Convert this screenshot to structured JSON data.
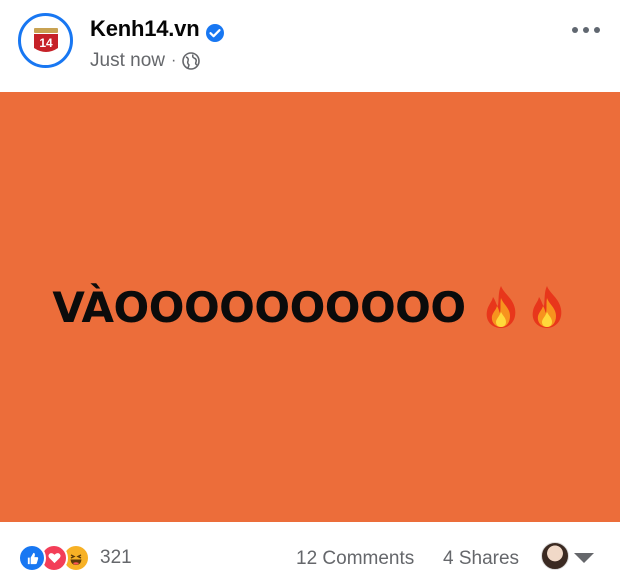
{
  "post": {
    "page_name": "Kenh14.vn",
    "verified": true,
    "timestamp": "Just now",
    "separator": "·",
    "privacy_icon": "globe-icon",
    "avatar_logo_text": "14",
    "more_icon": "more-options-icon",
    "image": {
      "background_color": "#ec6d3a",
      "text": "VÀOOOOOOOOOO",
      "emoji": [
        "fire-icon",
        "fire-icon"
      ]
    }
  },
  "footer": {
    "reaction_icons": [
      "like-icon",
      "love-icon",
      "haha-icon"
    ],
    "reaction_count": "321",
    "comments": "12 Comments",
    "shares": "4 Shares"
  }
}
